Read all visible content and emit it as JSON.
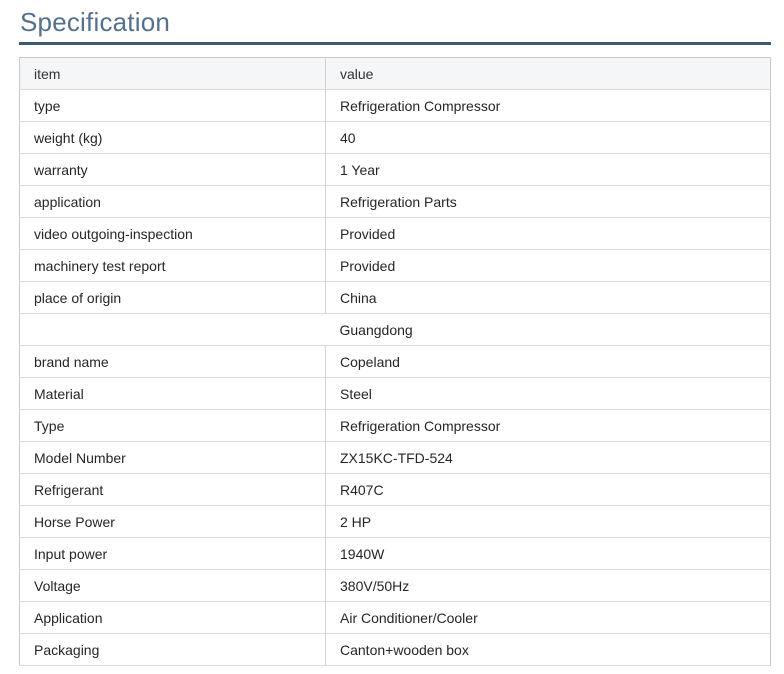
{
  "page": {
    "title": "Specification"
  },
  "colors": {
    "title_text": "#53708e",
    "title_rule": "#3e586f",
    "header_background": "#f5f6f8",
    "table_border": "#c9c9c9",
    "row_border": "#d9d9d9",
    "cell_text": "#262626"
  },
  "table": {
    "headers": {
      "item": "item",
      "value": "value"
    },
    "rows": [
      {
        "item": "type",
        "value": "Refrigeration Compressor"
      },
      {
        "item": "weight (kg)",
        "value": "40"
      },
      {
        "item": "warranty",
        "value": "1 Year"
      },
      {
        "item": "application",
        "value": "Refrigeration Parts"
      },
      {
        "item": "video outgoing-inspection",
        "value": "Provided"
      },
      {
        "item": "machinery test report",
        "value": "Provided"
      },
      {
        "item": "place of origin",
        "value": "China"
      },
      {
        "item": "",
        "value": "Guangdong"
      },
      {
        "item": "brand name",
        "value": "Copeland"
      },
      {
        "item": "Material",
        "value": "Steel"
      },
      {
        "item": "Type",
        "value": "Refrigeration Compressor"
      },
      {
        "item": "Model Number",
        "value": "ZX15KC-TFD-524"
      },
      {
        "item": "Refrigerant",
        "value": "R407C"
      },
      {
        "item": "Horse Power",
        "value": "2 HP"
      },
      {
        "item": "Input power",
        "value": "1940W"
      },
      {
        "item": "Voltage",
        "value": "380V/50Hz"
      },
      {
        "item": "Application",
        "value": "Air Conditioner/Cooler"
      },
      {
        "item": "Packaging",
        "value": "Canton+wooden box"
      }
    ]
  }
}
